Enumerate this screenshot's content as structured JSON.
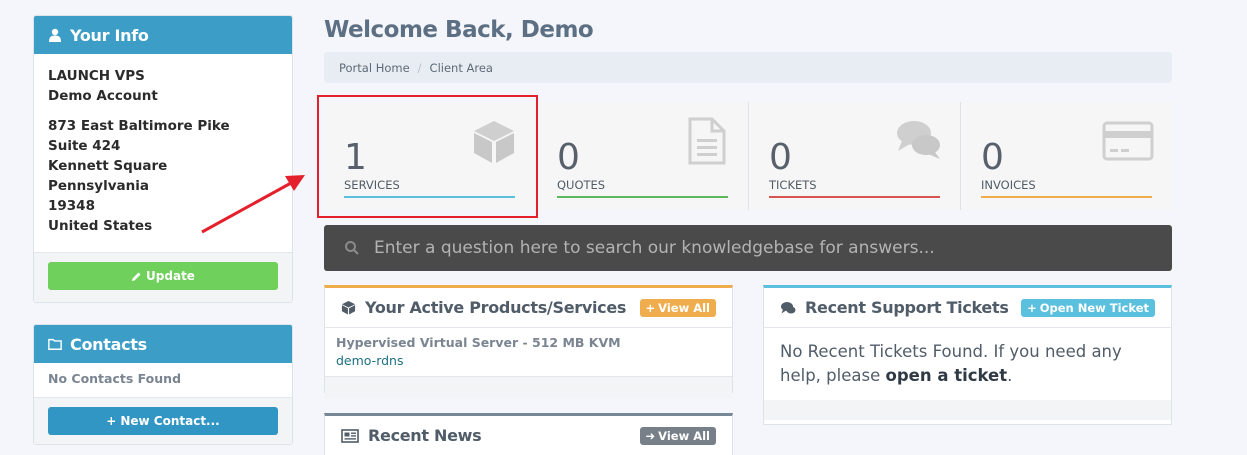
{
  "colors": {
    "accent": "#3c9ec6",
    "services": "#5bc0de",
    "quotes": "#5cb85c",
    "tickets": "#d9534f",
    "invoices": "#f0ad4e",
    "highlight": "#e3202c"
  },
  "your_info": {
    "title": "Your Info",
    "company": "LAUNCH VPS",
    "account": "Demo Account",
    "address1": "873 East Baltimore Pike",
    "address2": "Suite 424",
    "city": "Kennett Square",
    "state": "Pennsylvania",
    "zip": "19348",
    "country": "United States",
    "update_label": "Update"
  },
  "contacts": {
    "title": "Contacts",
    "empty_text": "No Contacts Found",
    "new_contact_label": "New Contact..."
  },
  "header": {
    "welcome": "Welcome Back, Demo",
    "breadcrumb": [
      "Portal Home",
      "Client Area"
    ]
  },
  "stats": [
    {
      "count": "1",
      "label": "SERVICES",
      "icon": "cube-icon"
    },
    {
      "count": "0",
      "label": "QUOTES",
      "icon": "document-icon"
    },
    {
      "count": "0",
      "label": "TICKETS",
      "icon": "comments-icon"
    },
    {
      "count": "0",
      "label": "INVOICES",
      "icon": "credit-card-icon"
    }
  ],
  "kb_search": {
    "placeholder": "Enter a question here to search our knowledgebase for answers..."
  },
  "products": {
    "title": "Your Active Products/Services",
    "view_all": "View All",
    "items": [
      {
        "name": "Hypervised Virtual Server - 512 MB KVM",
        "host": "demo-rdns"
      }
    ]
  },
  "tickets": {
    "title": "Recent Support Tickets",
    "open_label": "Open New Ticket",
    "empty_prefix": "No Recent Tickets Found. If you need any help, please",
    "empty_link": "open a ticket",
    "empty_suffix": "."
  },
  "news": {
    "title": "Recent News",
    "view_all": "View All"
  }
}
